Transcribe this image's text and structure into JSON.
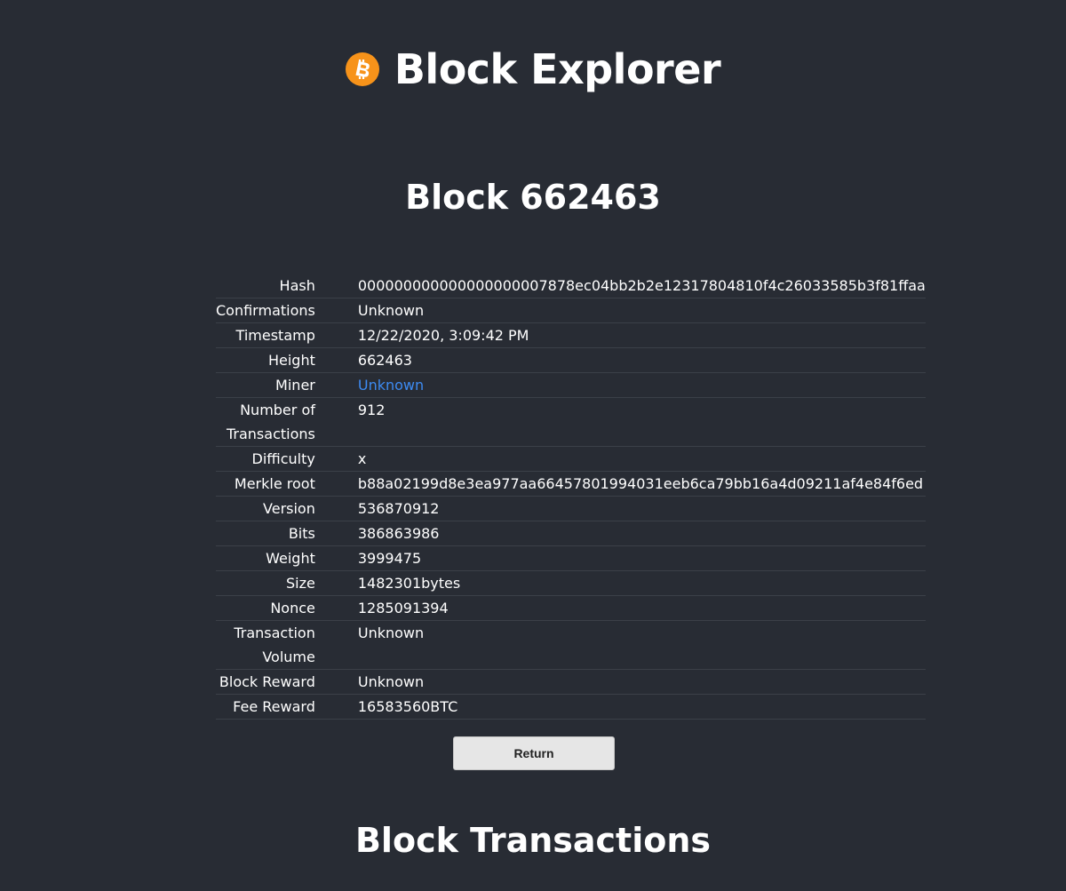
{
  "header": {
    "title": "Block Explorer",
    "logo_icon": "bitcoin-icon",
    "logo_color": "#f7931a"
  },
  "block": {
    "title": "Block 662463"
  },
  "details": {
    "hash": {
      "label": "Hash",
      "value": "000000000000000000007878ec04bb2b2e12317804810f4c26033585b3f81ffaa"
    },
    "confirmations": {
      "label": "Confirmations",
      "value": "Unknown"
    },
    "timestamp": {
      "label": "Timestamp",
      "value": "12/22/2020, 3:09:42 PM"
    },
    "height": {
      "label": "Height",
      "value": "662463"
    },
    "miner": {
      "label": "Miner",
      "value": "Unknown"
    },
    "num_transactions": {
      "label": "Number of Transactions",
      "value": "912"
    },
    "difficulty": {
      "label": "Difficulty",
      "value": "x"
    },
    "merkle_root": {
      "label": "Merkle root",
      "value": "b88a02199d8e3ea977aa66457801994031eeb6ca79bb16a4d09211af4e84f6ed"
    },
    "version": {
      "label": "Version",
      "value": "536870912"
    },
    "bits": {
      "label": "Bits",
      "value": "386863986"
    },
    "weight": {
      "label": "Weight",
      "value": "3999475"
    },
    "size": {
      "label": "Size",
      "value": "1482301bytes"
    },
    "nonce": {
      "label": "Nonce",
      "value": "1285091394"
    },
    "transaction_volume": {
      "label": "Transaction Volume",
      "value": "Unknown"
    },
    "block_reward": {
      "label": "Block Reward",
      "value": "Unknown"
    },
    "fee_reward": {
      "label": "Fee Reward",
      "value": "16583560BTC"
    }
  },
  "actions": {
    "return_label": "Return"
  },
  "transactions_section": {
    "title": "Block Transactions"
  },
  "colors": {
    "background": "#282c34",
    "link": "#3d8bf2",
    "accent": "#f7931a"
  }
}
